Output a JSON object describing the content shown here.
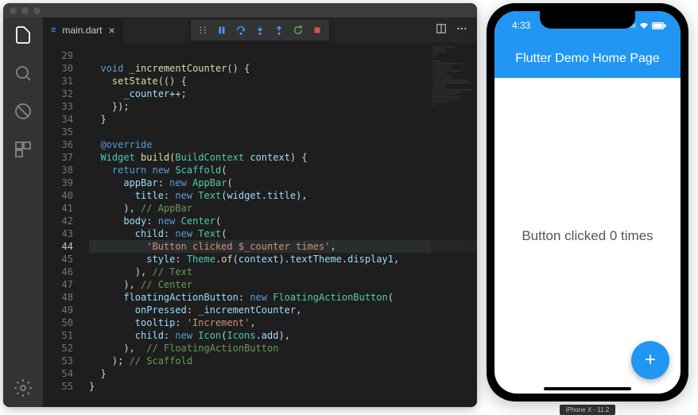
{
  "editor": {
    "tab_name": "main.dart",
    "line_start": 29,
    "active_line": 44,
    "line_count": 27,
    "lines": [
      {
        "n": 29,
        "h": ""
      },
      {
        "n": 30,
        "h": "  <span class='kw'>void</span> <span class='fn'>_incrementCounter</span>() {"
      },
      {
        "n": 31,
        "h": "    <span class='fn'>setState</span>(() {"
      },
      {
        "n": 32,
        "h": "      <span class='va'>_counter</span>++;"
      },
      {
        "n": 33,
        "h": "    });"
      },
      {
        "n": 34,
        "h": "  }"
      },
      {
        "n": 35,
        "h": ""
      },
      {
        "n": 36,
        "h": "  <span class='at'>@override</span>"
      },
      {
        "n": 37,
        "h": "  <span class='ty'>Widget</span> <span class='fn'>build</span>(<span class='ty'>BuildContext</span> <span class='va'>context</span>) {"
      },
      {
        "n": 38,
        "h": "    <span class='kw'>return new</span> <span class='ty'>Scaffold</span>("
      },
      {
        "n": 39,
        "h": "      <span class='va'>appBar</span>: <span class='kw'>new</span> <span class='ty'>AppBar</span>("
      },
      {
        "n": 40,
        "h": "        <span class='va'>title</span>: <span class='kw'>new</span> <span class='ty'>Text</span>(<span class='va'>widget</span>.<span class='va'>title</span>),"
      },
      {
        "n": 41,
        "h": "      ), <span class='cm'>// AppBar</span>"
      },
      {
        "n": 42,
        "h": "      <span class='va'>body</span>: <span class='kw'>new</span> <span class='ty'>Center</span>("
      },
      {
        "n": 43,
        "h": "        <span class='va'>child</span>: <span class='kw'>new</span> <span class='ty'>Text</span>("
      },
      {
        "n": 44,
        "h": "          <span class='st'>'Button clicked $_counter times'</span>,"
      },
      {
        "n": 45,
        "h": "          <span class='va'>style</span>: <span class='ty'>Theme</span>.<span class='fn'>of</span>(<span class='va'>context</span>).<span class='va'>textTheme</span>.<span class='va'>display1</span>,"
      },
      {
        "n": 46,
        "h": "        ), <span class='cm'>// Text</span>"
      },
      {
        "n": 47,
        "h": "      ), <span class='cm'>// Center</span>"
      },
      {
        "n": 48,
        "h": "      <span class='va'>floatingActionButton</span>: <span class='kw'>new</span> <span class='ty'>FloatingActionButton</span>("
      },
      {
        "n": 49,
        "h": "        <span class='va'>onPressed</span>: <span class='va'>_incrementCounter</span>,"
      },
      {
        "n": 50,
        "h": "        <span class='va'>tooltip</span>: <span class='st'>'Increment'</span>,"
      },
      {
        "n": 51,
        "h": "        <span class='va'>child</span>: <span class='kw'>new</span> <span class='ty'>Icon</span>(<span class='ty'>Icons</span>.<span class='va'>add</span>),"
      },
      {
        "n": 52,
        "h": "      ),  <span class='cm'>// FloatingActionButton</span>"
      },
      {
        "n": 53,
        "h": "    ); <span class='cm'>// Scaffold</span>"
      },
      {
        "n": 54,
        "h": "  }"
      },
      {
        "n": 55,
        "h": "}"
      }
    ]
  },
  "phone": {
    "time": "4:33",
    "signal": "•••",
    "wifi": "⬙",
    "battery": "▬",
    "app_title": "Flutter Demo Home Page",
    "body_text": "Button clicked 0 times",
    "fab_glyph": "+",
    "label": "iPhone X - 11.2"
  }
}
